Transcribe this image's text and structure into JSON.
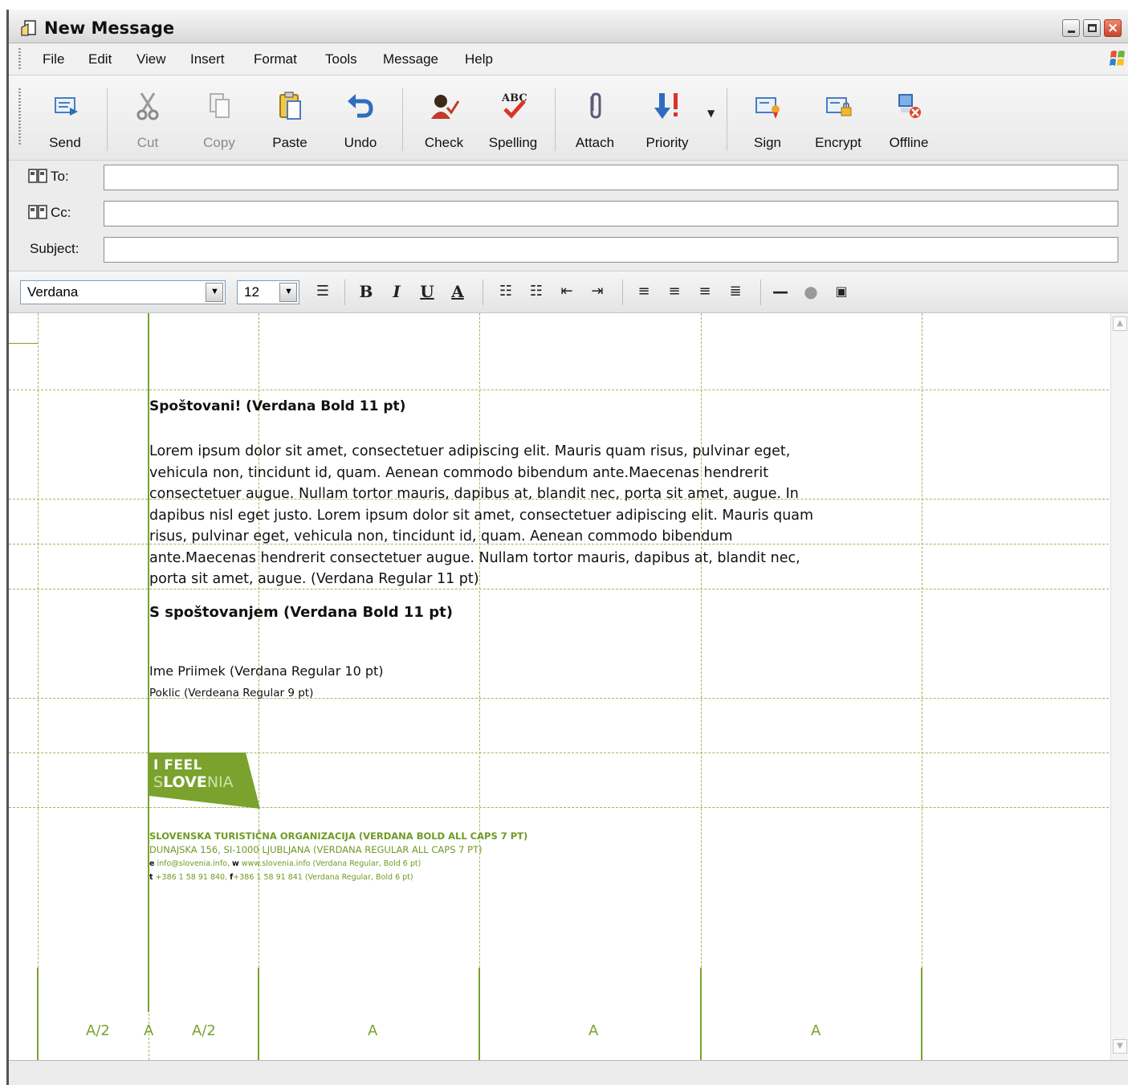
{
  "window": {
    "title": "New Message"
  },
  "menu": [
    "File",
    "Edit",
    "View",
    "Insert",
    "Format",
    "Tools",
    "Message",
    "Help"
  ],
  "toolbar": {
    "send": "Send",
    "cut": "Cut",
    "copy": "Copy",
    "paste": "Paste",
    "undo": "Undo",
    "check": "Check",
    "spelling": "Spelling",
    "attach": "Attach",
    "priority": "Priority",
    "sign": "Sign",
    "encrypt": "Encrypt",
    "offline": "Offline"
  },
  "fields": {
    "to_label": "To:",
    "cc_label": "Cc:",
    "subject_label": "Subject:",
    "to_value": "",
    "cc_value": "",
    "subject_value": ""
  },
  "format": {
    "font": "Verdana",
    "size": "12",
    "bold": "B",
    "italic": "I",
    "underline": "U",
    "font_color": "A"
  },
  "message": {
    "greeting": "Spoštovani! (Verdana Bold 11 pt)",
    "paragraph": "Lorem ipsum dolor sit amet, consectetuer adipiscing elit. Mauris quam risus, pulvinar eget, vehicula non, tincidunt id, quam. Aenean commodo bibendum ante.Maecenas hendrerit consectetuer augue. Nullam tortor mauris, dapibus at, blandit nec, porta sit amet, augue. In dapibus nisl eget justo. Lorem ipsum dolor sit amet, consectetuer adipiscing elit. Mauris quam risus, pulvinar eget, vehicula non, tincidunt id, quam. Aenean commodo bibendum ante.Maecenas hendrerit consectetuer augue. Nullam tortor mauris, dapibus at, blandit nec, porta sit amet, augue. (Verdana Regular 11 pt)",
    "closing": "S spoštovanjem (Verdana Bold 11 pt)",
    "name": "Ime Priimek (Verdana Regular 10 pt)",
    "job": "Poklic (Verdeana Regular 9 pt)"
  },
  "logo": {
    "line1": "I FEEL",
    "s_soft": "S",
    "love": "LOVE",
    "nia": "NIA"
  },
  "organization": {
    "line1": "SLOVENSKA TURISTIČNA ORGANIZACIJA (VERDANA BOLD ALL CAPS 7 PT)",
    "line2": "DUNAJSKA 156, SI-1000 LJUBLJANA (VERDANA REGULAR ALL CAPS 7 PT)",
    "line3_prefix": "e",
    "line3_a": " info@slovenia.info, ",
    "line3_prefix2": "w",
    "line3_b": " www.slovenia.info (Verdana Regular, Bold 6 pt)",
    "line4_prefix": "t",
    "line4_a": " +386 1 58 91 840, ",
    "line4_prefix2": "f",
    "line4_b": "+386 1 58 91 841 (Verdana Regular, Bold 6 pt)"
  },
  "columns": [
    "A/2",
    "A",
    "A/2",
    "A",
    "A",
    "A"
  ],
  "colors": {
    "guide_green": "#7aa22d",
    "logo_green": "#7aa22d"
  }
}
